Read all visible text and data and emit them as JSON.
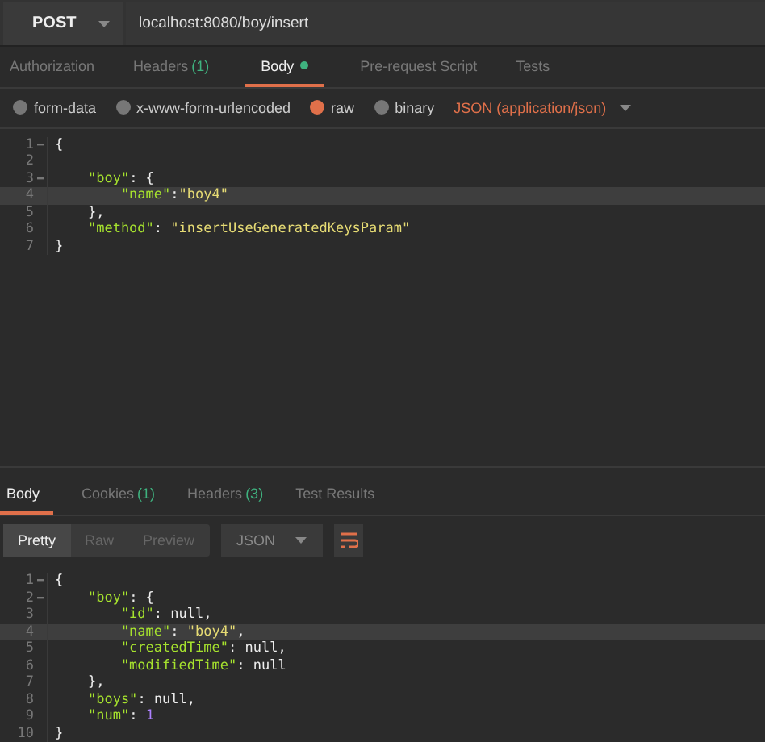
{
  "request": {
    "method": "POST",
    "url": "localhost:8080/boy/insert"
  },
  "request_tabs": [
    {
      "label": "Authorization",
      "selected": false
    },
    {
      "label": "Headers",
      "count": "(1)",
      "selected": false
    },
    {
      "label": "Body",
      "dot": true,
      "selected": true
    },
    {
      "label": "Pre-request Script",
      "selected": false
    },
    {
      "label": "Tests",
      "selected": false
    }
  ],
  "body_types": [
    {
      "label": "form-data",
      "selected": false
    },
    {
      "label": "x-www-form-urlencoded",
      "selected": false
    },
    {
      "label": "raw",
      "selected": true
    },
    {
      "label": "binary",
      "selected": false
    }
  ],
  "content_type": "JSON (application/json)",
  "request_editor": [
    {
      "number": "1",
      "foldable": true,
      "current": false,
      "tokens": [
        {
          "kind": "punct",
          "text": "{"
        }
      ]
    },
    {
      "number": "2",
      "foldable": false,
      "current": false
    },
    {
      "number": "3",
      "foldable": true,
      "current": false,
      "tokens": [
        {
          "kind": "key",
          "text": "    \"boy\""
        },
        {
          "kind": "punct",
          "text": ": {"
        }
      ]
    },
    {
      "number": "4",
      "foldable": false,
      "current": true,
      "tokens": [
        {
          "kind": "key",
          "text": "        \"name\""
        },
        {
          "kind": "punct",
          "text": ":"
        },
        {
          "kind": "string",
          "text": "\"boy4\""
        }
      ]
    },
    {
      "number": "5",
      "foldable": false,
      "current": false,
      "tokens": [
        {
          "kind": "punct",
          "text": "    },"
        }
      ]
    },
    {
      "number": "6",
      "foldable": false,
      "current": false,
      "tokens": [
        {
          "kind": "key",
          "text": "    \"method\""
        },
        {
          "kind": "punct",
          "text": ": "
        },
        {
          "kind": "string",
          "text": "\"insertUseGeneratedKeysParam\""
        }
      ]
    },
    {
      "number": "7",
      "foldable": false,
      "current": false,
      "tokens": [
        {
          "kind": "punct",
          "text": "}"
        }
      ]
    }
  ],
  "response_tabs": [
    {
      "label": "Body",
      "selected": true
    },
    {
      "label": "Cookies",
      "count": "(1)",
      "selected": false
    },
    {
      "label": "Headers",
      "count": "(3)",
      "selected": false
    },
    {
      "label": "Test Results",
      "selected": false
    }
  ],
  "view_modes": [
    {
      "label": "Pretty",
      "selected": true
    },
    {
      "label": "Raw",
      "selected": false
    },
    {
      "label": "Preview",
      "selected": false
    }
  ],
  "response_format": "JSON",
  "response_editor": [
    {
      "number": "1",
      "foldable": true,
      "current": false,
      "tokens": [
        {
          "kind": "punct",
          "text": "{"
        }
      ]
    },
    {
      "number": "2",
      "foldable": true,
      "current": false,
      "tokens": [
        {
          "kind": "key",
          "text": "    \"boy\""
        },
        {
          "kind": "punct",
          "text": ": {"
        }
      ]
    },
    {
      "number": "3",
      "foldable": false,
      "current": false,
      "tokens": [
        {
          "kind": "key",
          "text": "        \"id\""
        },
        {
          "kind": "punct",
          "text": ": "
        },
        {
          "kind": "null",
          "text": "null"
        },
        {
          "kind": "punct",
          "text": ","
        }
      ]
    },
    {
      "number": "4",
      "foldable": false,
      "current": true,
      "tokens": [
        {
          "kind": "key",
          "text": "        \"name\""
        },
        {
          "kind": "punct",
          "text": ": "
        },
        {
          "kind": "string",
          "text": "\"boy4\""
        },
        {
          "kind": "punct",
          "text": ","
        }
      ]
    },
    {
      "number": "5",
      "foldable": false,
      "current": false,
      "tokens": [
        {
          "kind": "key",
          "text": "        \"createdTime\""
        },
        {
          "kind": "punct",
          "text": ": "
        },
        {
          "kind": "null",
          "text": "null"
        },
        {
          "kind": "punct",
          "text": ","
        }
      ]
    },
    {
      "number": "6",
      "foldable": false,
      "current": false,
      "tokens": [
        {
          "kind": "key",
          "text": "        \"modifiedTime\""
        },
        {
          "kind": "punct",
          "text": ": "
        },
        {
          "kind": "null",
          "text": "null"
        }
      ]
    },
    {
      "number": "7",
      "foldable": false,
      "current": false,
      "tokens": [
        {
          "kind": "punct",
          "text": "    },"
        }
      ]
    },
    {
      "number": "8",
      "foldable": false,
      "current": false,
      "tokens": [
        {
          "kind": "key",
          "text": "    \"boys\""
        },
        {
          "kind": "punct",
          "text": ": "
        },
        {
          "kind": "null",
          "text": "null"
        },
        {
          "kind": "punct",
          "text": ","
        }
      ]
    },
    {
      "number": "9",
      "foldable": false,
      "current": false,
      "tokens": [
        {
          "kind": "key",
          "text": "    \"num\""
        },
        {
          "kind": "punct",
          "text": ": "
        },
        {
          "kind": "number",
          "text": "1"
        }
      ]
    },
    {
      "number": "10",
      "foldable": false,
      "current": false,
      "tokens": [
        {
          "kind": "punct",
          "text": "}"
        }
      ]
    }
  ]
}
